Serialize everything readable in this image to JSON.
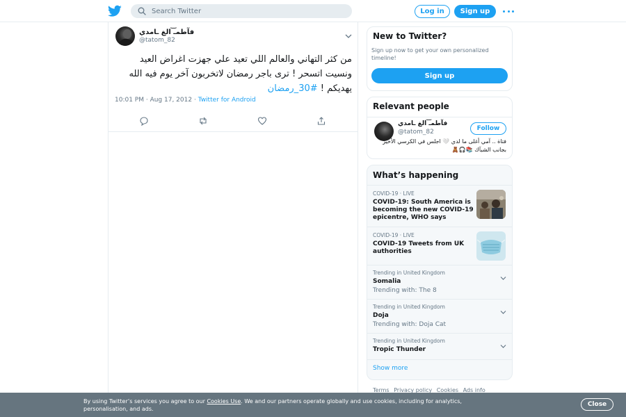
{
  "header": {
    "search_placeholder": "Search Twitter",
    "login_label": "Log in",
    "signup_label": "Sign up",
    "logo_icon": "twitter-bird-icon",
    "more_icon": "more-dots-icon",
    "accent_color": "#1da1f2"
  },
  "tweet": {
    "author_name": "فآطمـ͝ الغ ـامدي",
    "author_handle": "@tatom_82",
    "text_main": "من كثر التهاني والعالم اللي تعيد علي جهزت اغراض العيد ونسيت اتسحر ! ترى باجر رمضان لاتخربون آخر يوم فيه الله يهديكم ! ",
    "hashtag": "#30_رمضان",
    "timestamp": "10:01 PM · Aug 17, 2012",
    "source_sep": " · ",
    "source": "Twitter for Android",
    "actions": [
      "reply-icon",
      "retweet-icon",
      "like-icon",
      "share-icon"
    ]
  },
  "new_to_twitter": {
    "title": "New to Twitter?",
    "subtitle": "Sign up now to get your own personalized timeline!",
    "signup_label": "Sign up"
  },
  "relevant_people": {
    "title": "Relevant people",
    "name": "فآطمـ͝ الغ ـامدي",
    "handle": "@tatom_82",
    "follow_label": "Follow",
    "bio": "فتاة .. آمي أغلى ما لدي 🤍 اجلس في الكرسي الأخير بجانب الشبآك 📚🎧🧸"
  },
  "whats_happening": {
    "title": "What’s happening",
    "news": [
      {
        "category": "COVID-19 · LIVE",
        "headline": "COVID-19: South America is becoming the new COVID-19 epicentre, WHO says"
      },
      {
        "category": "COVID-19 · LIVE",
        "headline": "COVID-19 Tweets from UK authorities"
      }
    ],
    "trends": [
      {
        "location": "Trending in United Kingdom",
        "name": "Somalia",
        "with": "Trending with: The 8"
      },
      {
        "location": "Trending in United Kingdom",
        "name": "Doja",
        "with": "Trending with: Doja Cat"
      },
      {
        "location": "Trending in United Kingdom",
        "name": "Tropic Thunder",
        "with": ""
      }
    ],
    "show_more": "Show more"
  },
  "footer": {
    "links": [
      "Terms",
      "Privacy policy",
      "Cookies",
      "Ads info"
    ]
  },
  "cookie_bar": {
    "text_before": "By using Twitter’s services you agree to our ",
    "link": "Cookies Use",
    "text_after": ". We and our partners operate globally and use cookies, including for analytics, personalisation, and ads.",
    "close_label": "Close"
  }
}
